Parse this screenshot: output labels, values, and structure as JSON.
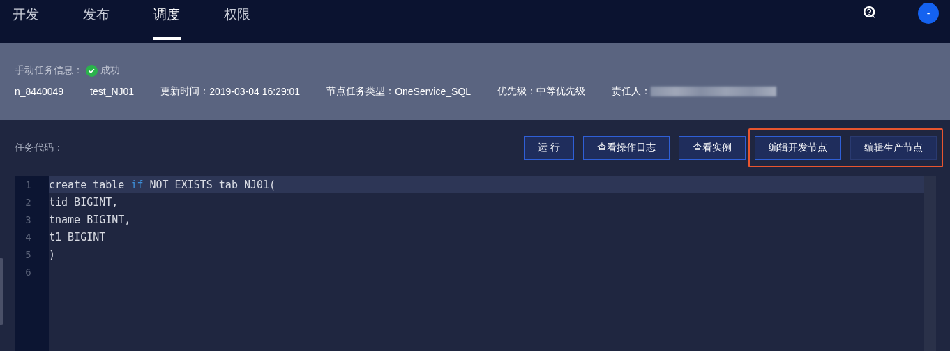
{
  "nav": {
    "tabs": [
      {
        "label": "开发",
        "selected": false
      },
      {
        "label": "发布",
        "selected": false
      },
      {
        "label": "调度",
        "selected": true
      },
      {
        "label": "权限",
        "selected": false
      }
    ],
    "avatar": "-"
  },
  "info": {
    "title": "手动任务信息：",
    "status": "成功",
    "fields": [
      {
        "value": "n_8440049"
      },
      {
        "value": "test_NJ01"
      },
      {
        "label": "更新时间：",
        "value": "2019-03-04 16:29:01"
      },
      {
        "label": "节点任务类型：",
        "value": "OneService_SQL"
      },
      {
        "label": "优先级：",
        "value": "中等优先级"
      },
      {
        "label": "责任人：",
        "redacted": true
      }
    ]
  },
  "code_section": {
    "title": "任务代码：",
    "buttons": [
      {
        "label": "运 行",
        "highlighted": false,
        "bordered": true
      },
      {
        "label": "查看操作日志",
        "highlighted": false,
        "bordered": true
      },
      {
        "label": "查看实例",
        "highlighted": false,
        "bordered": true
      },
      {
        "label": "编辑开发节点",
        "highlighted": true,
        "bordered": true
      },
      {
        "label": "编辑生产节点",
        "highlighted": true,
        "bordered": false
      }
    ]
  },
  "editor": {
    "lines": [
      {
        "number": "1",
        "active": true,
        "tokens": [
          {
            "text": "create table ",
            "kind": "plain"
          },
          {
            "text": "if",
            "kind": "keyword"
          },
          {
            "text": " NOT EXISTS tab_NJ01(",
            "kind": "plain"
          }
        ]
      },
      {
        "number": "2",
        "active": false,
        "tokens": [
          {
            "text": "tid BIGINT,",
            "kind": "plain"
          }
        ]
      },
      {
        "number": "3",
        "active": false,
        "tokens": [
          {
            "text": "tname BIGINT,",
            "kind": "plain"
          }
        ]
      },
      {
        "number": "4",
        "active": false,
        "tokens": [
          {
            "text": "t1 BIGINT",
            "kind": "plain"
          }
        ]
      },
      {
        "number": "5",
        "active": false,
        "tokens": [
          {
            "text": ")",
            "kind": "plain"
          }
        ]
      },
      {
        "number": "6",
        "active": false
      }
    ]
  }
}
